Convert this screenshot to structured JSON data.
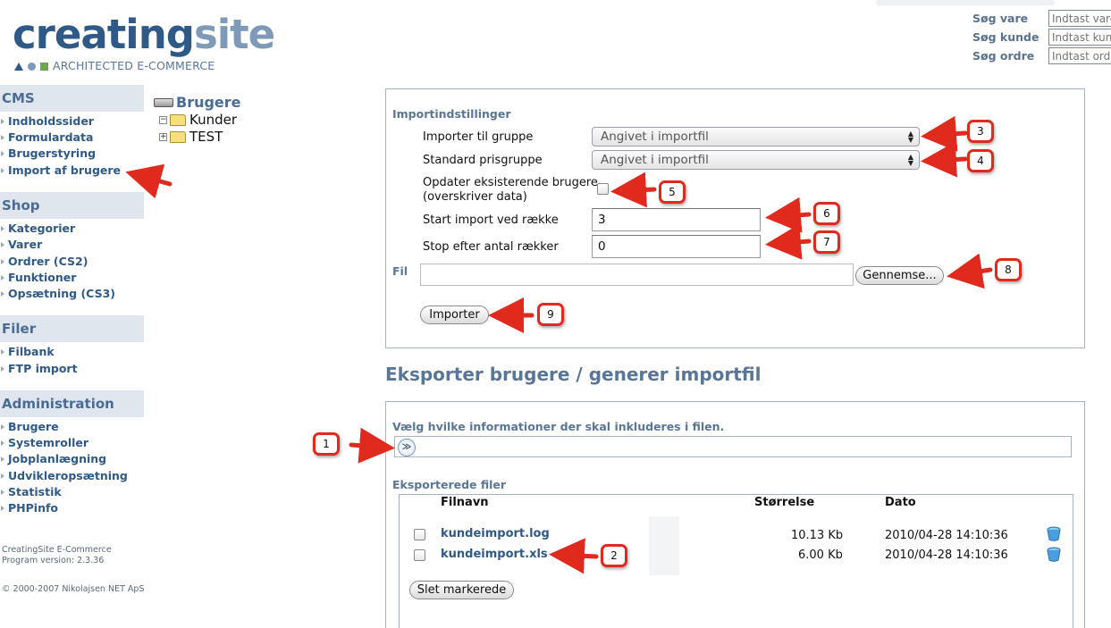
{
  "header": {
    "logo_part1": "creating",
    "logo_part2": "site",
    "tagline": "ARCHITECTED E-COMMERCE",
    "search": [
      {
        "label": "Søg vare",
        "placeholder": "Indtast vare"
      },
      {
        "label": "Søg kunde",
        "placeholder": "Indtast kunde"
      },
      {
        "label": "Søg ordre",
        "placeholder": "Indtast ordre"
      }
    ]
  },
  "sidebar": {
    "sections": [
      {
        "title": "CMS",
        "items": [
          "Indholdssider",
          "Formulardata",
          "Brugerstyring",
          "Import af brugere"
        ]
      },
      {
        "title": "Shop",
        "items": [
          "Kategorier",
          "Varer",
          "Ordrer (CS2)",
          "Funktioner",
          "Opsætning (CS3)"
        ]
      },
      {
        "title": "Filer",
        "items": [
          "Filbank",
          "FTP import"
        ]
      },
      {
        "title": "Administration",
        "items": [
          "Brugere",
          "Systemroller",
          "Jobplanlægning",
          "Udvikleropsætning",
          "Statistik",
          "PHPinfo"
        ]
      }
    ],
    "footer_line1": "CreatingSite E-Commerce",
    "footer_line2": "Program version: 2.3.36",
    "copyright": "© 2000-2007 Nikolajsen NET ApS"
  },
  "tree": {
    "root": "Brugere",
    "nodes": [
      "Kunder",
      "TEST"
    ]
  },
  "import": {
    "title": "Importindstillinger",
    "group_label": "Importer til gruppe",
    "group_value": "Angivet i importfil",
    "price_label": "Standard prisgruppe",
    "price_value": "Angivet i importfil",
    "update_label_line1": "Opdater eksisterende brugere",
    "update_label_line2": "(overskriver data)",
    "start_label": "Start import ved række",
    "start_value": "3",
    "stop_label": "Stop efter antal rækker",
    "stop_value": "0",
    "file_label": "Fil",
    "browse_button": "Gennemse...",
    "import_button": "Importer"
  },
  "export": {
    "title": "Eksporter brugere / generer importfil",
    "choose_info": "Vælg hvilke informationer der skal inkluderes i filen.",
    "files_title": "Eksporterede filer",
    "columns": [
      "Filnavn",
      "Størrelse",
      "Dato"
    ],
    "files": [
      {
        "name": "kundeimport.log",
        "size": "10.13 Kb",
        "date": "2010/04-28 14:10:36"
      },
      {
        "name": "kundeimport.xls",
        "size": "6.00 Kb",
        "date": "2010/04-28 14:10:36"
      }
    ],
    "delete_button": "Slet markerede"
  },
  "callouts": [
    "1",
    "2",
    "3",
    "4",
    "5",
    "6",
    "7",
    "8",
    "9"
  ],
  "colors": {
    "brand_dark": "#2f5a88",
    "brand_light": "#7f9ab8",
    "sidebar_header_bg": "#dfe6ee",
    "callout_red": "#e02a1e"
  }
}
